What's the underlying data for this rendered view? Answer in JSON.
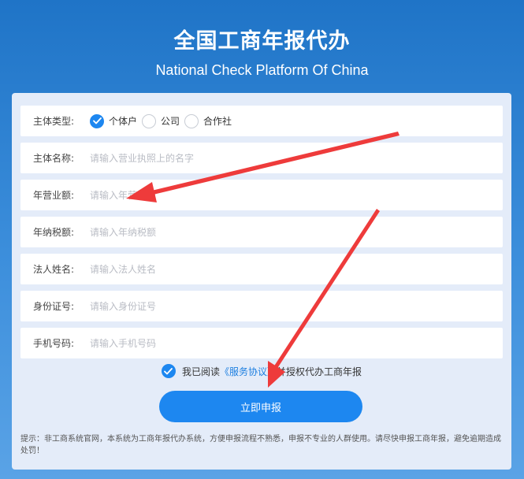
{
  "header": {
    "title": "全国工商年报代办",
    "subtitle": "National Check Platform Of China"
  },
  "form": {
    "entity_type": {
      "label": "主体类型:",
      "options": [
        {
          "label": "个体户",
          "checked": true
        },
        {
          "label": "公司",
          "checked": false
        },
        {
          "label": "合作社",
          "checked": false
        }
      ]
    },
    "fields": [
      {
        "label": "主体名称:",
        "placeholder": "请输入营业执照上的名字",
        "value": ""
      },
      {
        "label": "年营业额:",
        "placeholder": "请输入年营业额",
        "value": ""
      },
      {
        "label": "年纳税额:",
        "placeholder": "请输入年纳税额",
        "value": ""
      },
      {
        "label": "法人姓名:",
        "placeholder": "请输入法人姓名",
        "value": ""
      },
      {
        "label": "身份证号:",
        "placeholder": "请输入身份证号",
        "value": ""
      },
      {
        "label": "手机号码:",
        "placeholder": "请输入手机号码",
        "value": ""
      }
    ],
    "agreement": {
      "prefix": "我已阅读",
      "link": "《服务协议》",
      "suffix": "并授权代办工商年报",
      "checked": true
    },
    "submit_label": "立即申报",
    "notice": "提示：非工商系统官网，本系统为工商年报代办系统，方便申报流程不熟悉，申报不专业的人群使用。请尽快申报工商年报，避免逾期造成处罚！"
  },
  "colors": {
    "accent": "#1d87f0",
    "background": "#2b80d0",
    "card": "#e4ecf9",
    "annotation_arrow": "#ee3b3b"
  },
  "icons": [
    "check-icon",
    "arrow-annotation"
  ]
}
